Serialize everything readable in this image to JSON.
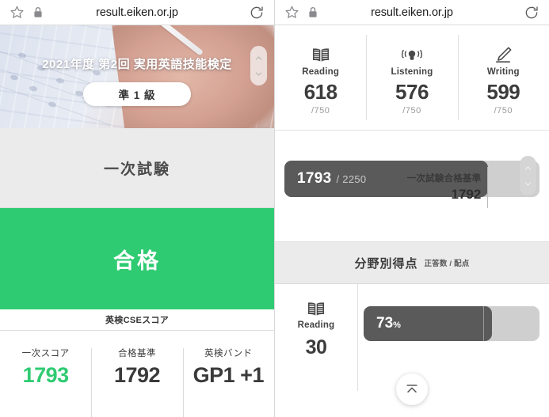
{
  "browser": {
    "url": "result.eiken.or.jp",
    "star_icon": "star-icon",
    "lock_icon": "lock-icon",
    "reload_icon": "reload-icon"
  },
  "left": {
    "hero": {
      "title": "2021年度 第2回 実用英語技能検定",
      "grade_badge": "準 1 級"
    },
    "section_title": "一次試験",
    "result_banner": {
      "text": "合格",
      "color": "#2fcb72"
    },
    "cse_label": "英検CSEスコア",
    "score_columns": [
      {
        "label": "一次スコア",
        "value": "1793",
        "color": "#2fcb72"
      },
      {
        "label": "合格基準",
        "value": "1792",
        "color": "#3a3a3a"
      },
      {
        "label": "英検バンド",
        "value": "GP1 +1",
        "color": "#3a3a3a"
      }
    ]
  },
  "right": {
    "skills": [
      {
        "icon": "book-icon",
        "name": "Reading",
        "score": "618",
        "max": "/750"
      },
      {
        "icon": "listening-icon",
        "name": "Listening",
        "score": "576",
        "max": "/750"
      },
      {
        "icon": "pencil-icon",
        "name": "Writing",
        "score": "599",
        "max": "/750"
      }
    ],
    "total": {
      "value": "1793",
      "max": "/ 2250",
      "threshold_label": "一次試験合格基準",
      "threshold_value": "1792",
      "fill_percent": 79.7,
      "threshold_percent": 79.6
    },
    "breakdown": {
      "title": "分野別得点",
      "subtitle": "正答数 / 配点",
      "rows": [
        {
          "icon": "book-icon",
          "name": "Reading",
          "number": "30",
          "percent_text": "73",
          "percent_suffix": "%",
          "fill_percent": 73,
          "mark_percent": 68
        }
      ]
    },
    "scroll_top_button": "scroll-to-top-icon"
  }
}
